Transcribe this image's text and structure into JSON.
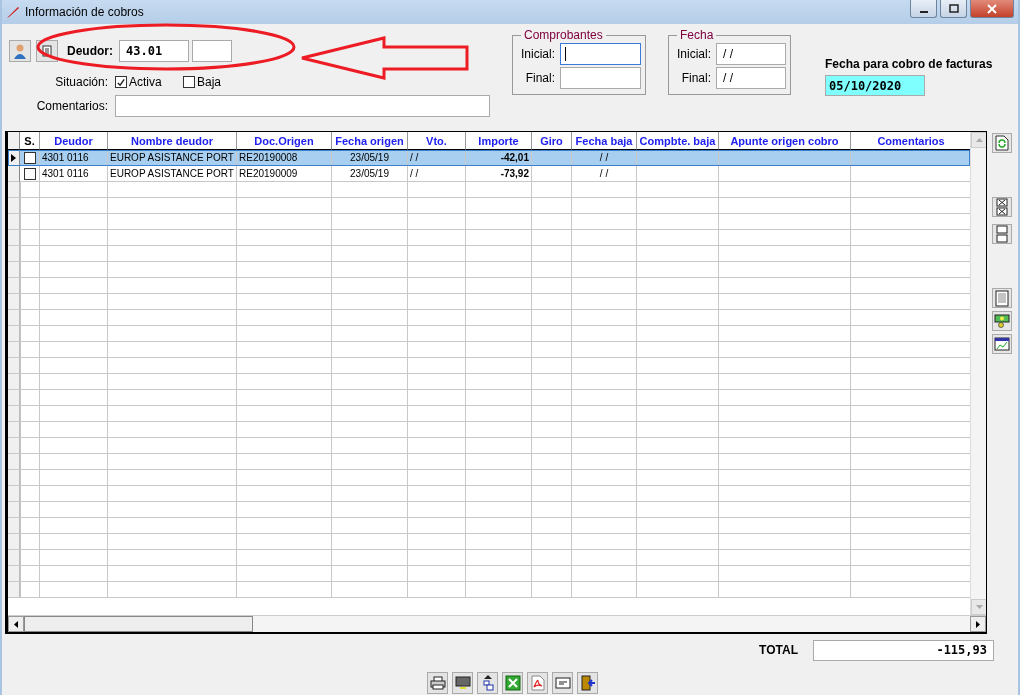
{
  "window": {
    "title": "Información de cobros"
  },
  "deudor": {
    "label": "Deudor:",
    "value": "43.01"
  },
  "situacion": {
    "label": "Situación:",
    "options": [
      {
        "label": "Activa",
        "checked": true
      },
      {
        "label": "Baja",
        "checked": false
      }
    ]
  },
  "comentarios": {
    "label": "Comentarios:"
  },
  "comprobantes": {
    "title": "Comprobantes",
    "fields": [
      {
        "label": "Inicial:",
        "focused": true
      },
      {
        "label": "Final:",
        "focused": false
      }
    ]
  },
  "fecha": {
    "title": "Fecha",
    "fields": [
      {
        "label": "Inicial:",
        "value": "/ /"
      },
      {
        "label": "Final:",
        "value": "/ /"
      }
    ]
  },
  "fecha_cobro": {
    "label": "Fecha para cobro de facturas",
    "value": "05/10/2020"
  },
  "table": {
    "columns": [
      "S.",
      "Deudor",
      "Nombre deudor",
      "Doc.Origen",
      "Fecha origen",
      "Vto.",
      "Importe",
      "Giro",
      "Fecha baja",
      "Compbte. baja",
      "Apunte origen cobro",
      "Comentarios"
    ],
    "rows": [
      {
        "selected": true,
        "checked": false,
        "deudor": "4301  0116",
        "nombre_deudor": "EUROP ASISTANCE PORT",
        "doc_origen": "RE20190008",
        "fecha_origen": "23/05/19",
        "vto": "/ /",
        "importe": "-42,01",
        "fecha_baja": "/ /"
      },
      {
        "selected": false,
        "checked": false,
        "deudor": "4301  0116",
        "nombre_deudor": "EUROP ASISTANCE PORT",
        "doc_origen": "RE20190009",
        "fecha_origen": "23/05/19",
        "vto": "/ /",
        "importe": "-73,92",
        "fecha_baja": "/ /"
      }
    ]
  },
  "total": {
    "label": "TOTAL",
    "value": "-115,93"
  }
}
